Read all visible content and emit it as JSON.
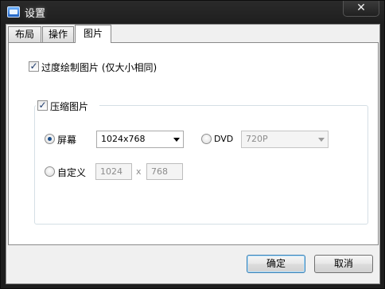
{
  "window": {
    "title": "设置",
    "close_glyph": "✕"
  },
  "tabs": [
    {
      "label": "布局"
    },
    {
      "label": "操作"
    },
    {
      "label": "图片",
      "active": true
    }
  ],
  "options": {
    "overdraw": {
      "label": "过度绘制图片 (仅大小相同)",
      "checked": true,
      "glyph": "✓"
    },
    "compress": {
      "label": "压缩图片",
      "checked": true,
      "glyph": "✓"
    }
  },
  "compress_group": {
    "screen": {
      "label": "屏幕",
      "selected": true,
      "value": "1024x768"
    },
    "dvd": {
      "label": "DVD",
      "selected": false,
      "value": "720P"
    },
    "custom": {
      "label": "自定义",
      "selected": false,
      "width": "1024",
      "separator": "x",
      "height": "768"
    }
  },
  "buttons": {
    "ok": "确定",
    "cancel": "取消"
  },
  "colors": {
    "titlebar": "#1e1e1e",
    "client": "#f0f0f0",
    "panel": "#ffffff",
    "default_button_border": "#3c7fb1"
  },
  "icons": {
    "window": "settings-app-icon",
    "close": "close-icon",
    "dropdown": "chevron-down-icon",
    "check": "checkmark-icon"
  }
}
